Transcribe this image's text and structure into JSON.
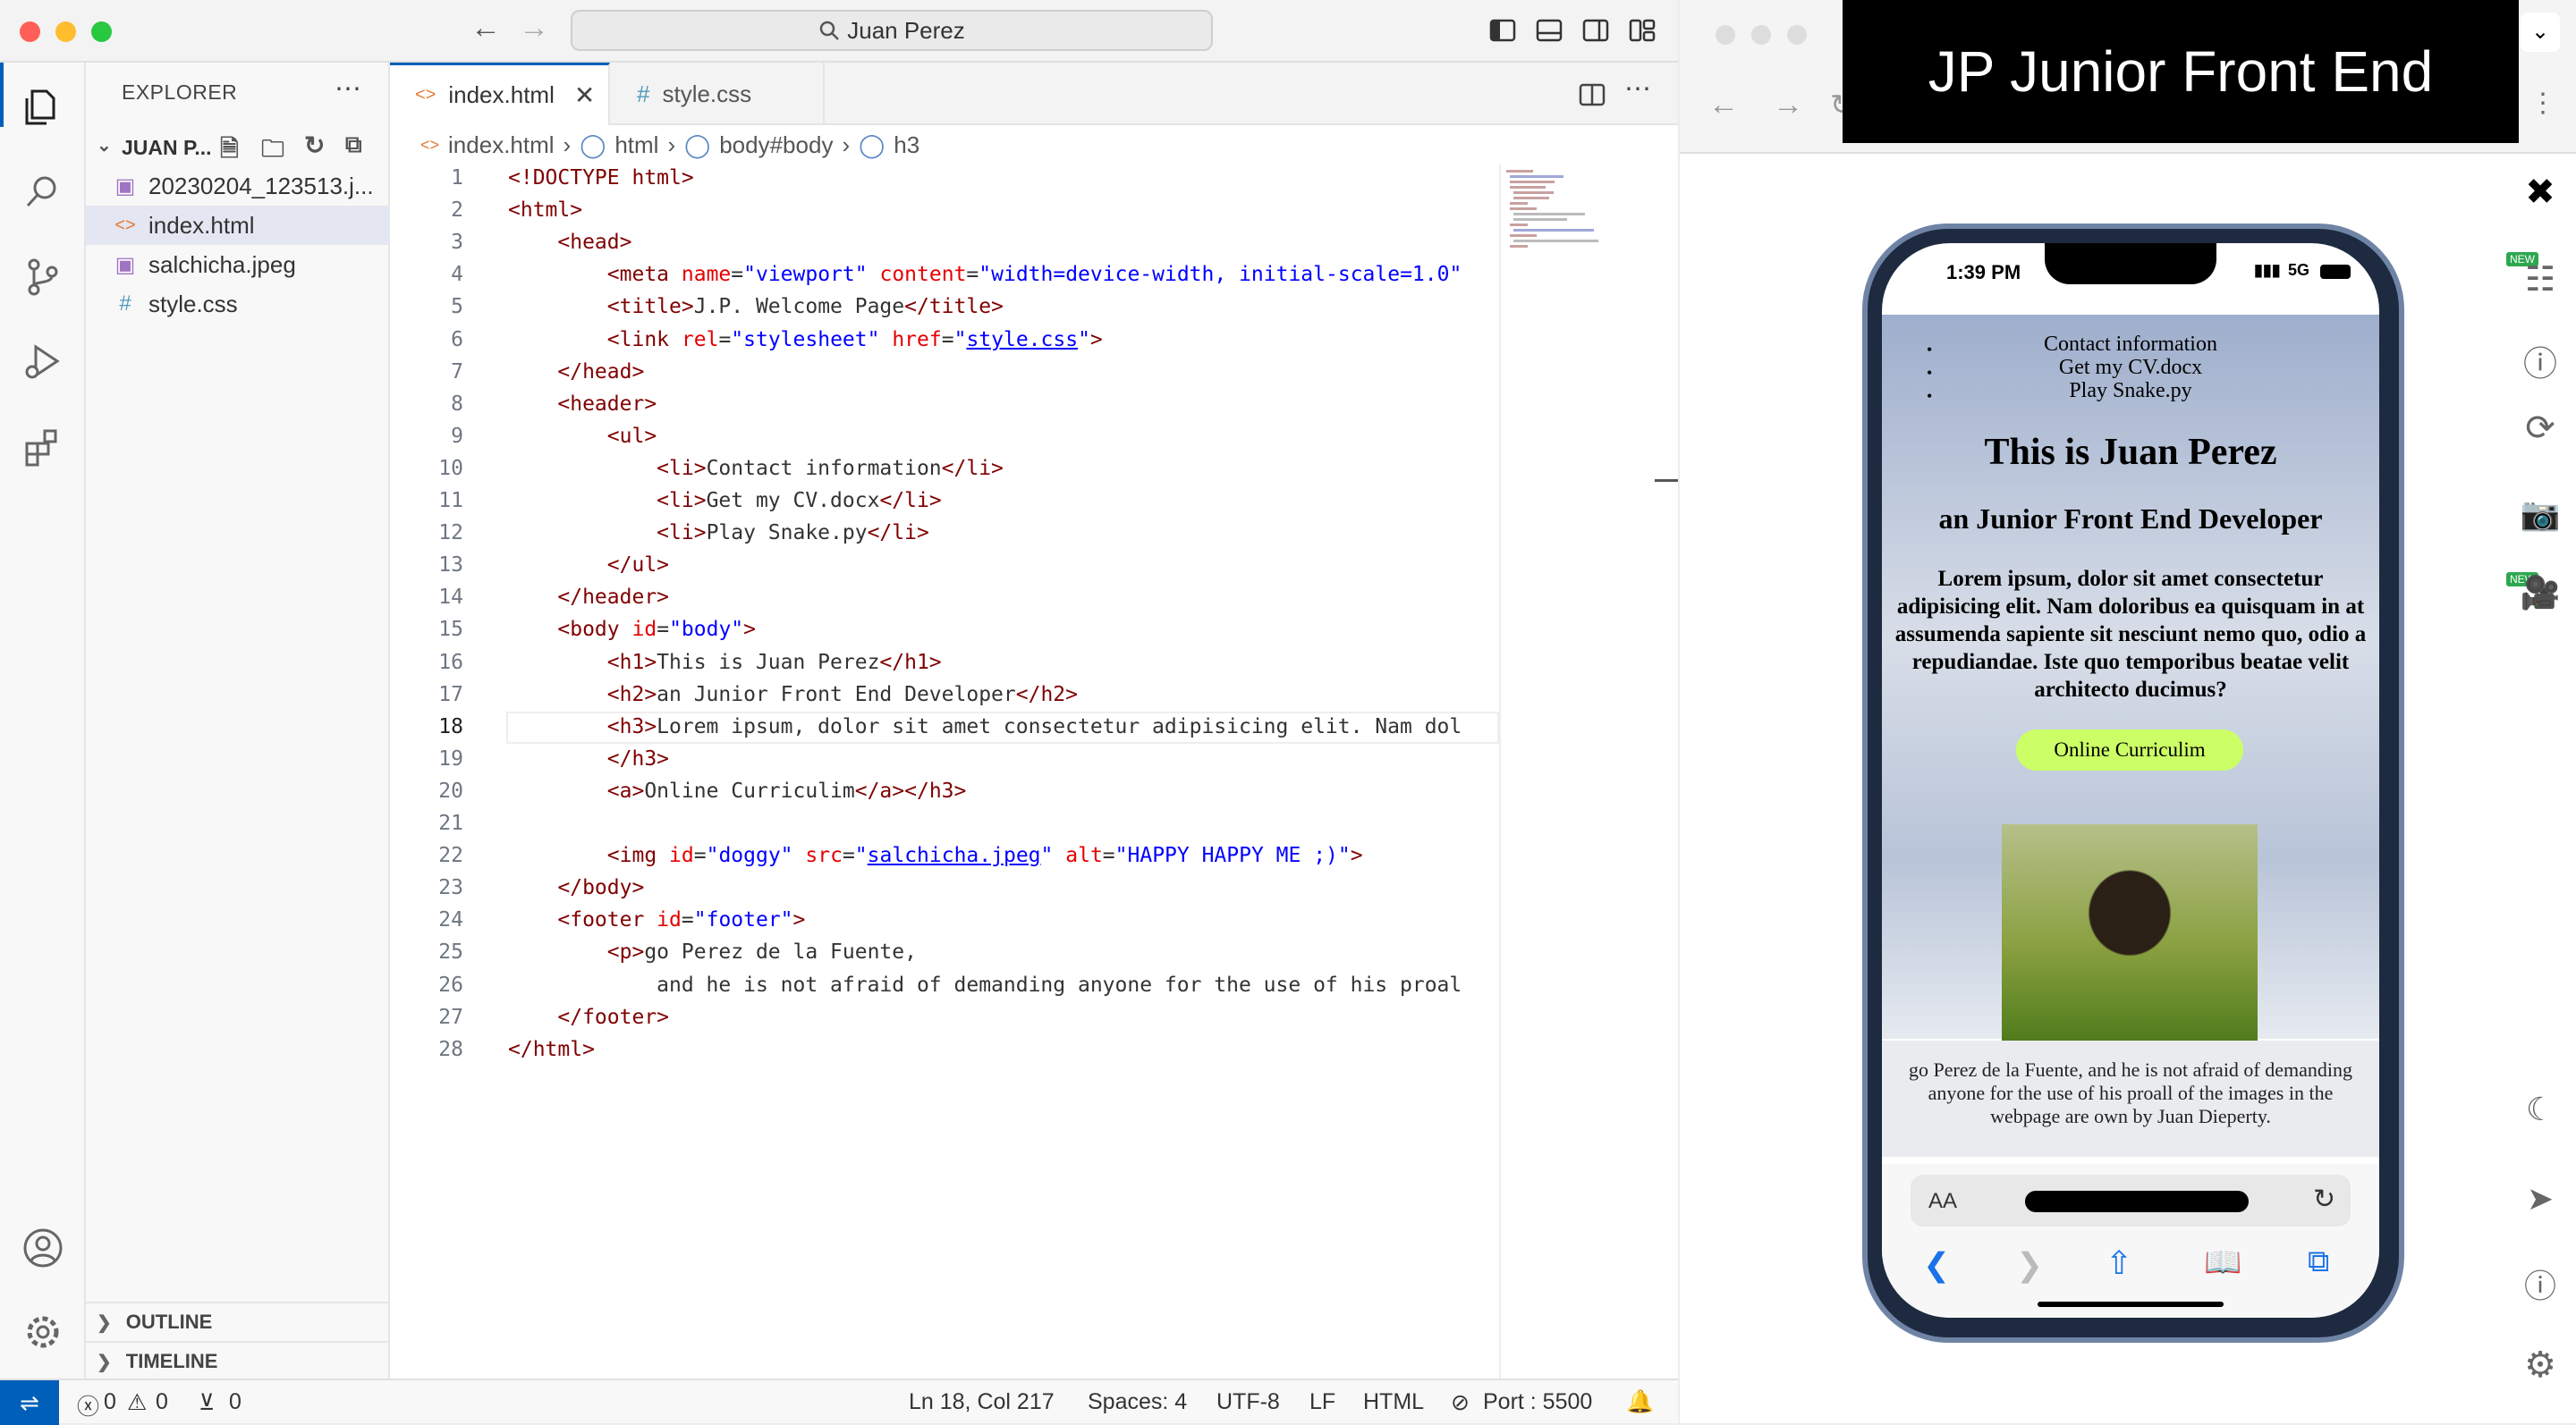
{
  "titlebar": {
    "search_text": "Juan Perez"
  },
  "explorer": {
    "title": "EXPLORER",
    "folder": "JUAN P...",
    "files": [
      {
        "name": "20230204_123513.j...",
        "icon": "image-icon"
      },
      {
        "name": "index.html",
        "icon": "html-icon"
      },
      {
        "name": "salchicha.jpeg",
        "icon": "image-icon"
      },
      {
        "name": "style.css",
        "icon": "css-icon"
      }
    ],
    "outline": "OUTLINE",
    "timeline": "TIMELINE"
  },
  "tabs": [
    {
      "label": "index.html",
      "icon": "<>"
    },
    {
      "label": "style.css",
      "icon": "#"
    }
  ],
  "breadcrumb": [
    "index.html",
    "html",
    "body#body",
    "h3"
  ],
  "code_lines": [
    {
      "n": "1",
      "html": "<span class=\"tg\">&lt;!DOCTYPE html&gt;</span>"
    },
    {
      "n": "2",
      "html": "<span class=\"tg\">&lt;html&gt;</span>"
    },
    {
      "n": "3",
      "html": "    <span class=\"tg\">&lt;head&gt;</span>"
    },
    {
      "n": "4",
      "html": "        <span class=\"tg\">&lt;meta</span> <span class=\"at\">name</span>=<span class=\"st\">\"viewport\"</span> <span class=\"at\">content</span>=<span class=\"st\">\"width=device-width, initial-scale=1.0\"</span>"
    },
    {
      "n": "5",
      "html": "        <span class=\"tg\">&lt;title&gt;</span>J.P. Welcome Page<span class=\"tg\">&lt;/title&gt;</span>"
    },
    {
      "n": "6",
      "html": "        <span class=\"tg\">&lt;link</span> <span class=\"at\">rel</span>=<span class=\"st\">\"stylesheet\"</span> <span class=\"at\">href</span>=<span class=\"st\">\"</span><span class=\"u\">style.css</span><span class=\"st\">\"</span><span class=\"tg\">&gt;</span>"
    },
    {
      "n": "7",
      "html": "    <span class=\"tg\">&lt;/head&gt;</span>"
    },
    {
      "n": "8",
      "html": "    <span class=\"tg\">&lt;header&gt;</span>"
    },
    {
      "n": "9",
      "html": "        <span class=\"tg\">&lt;ul&gt;</span>"
    },
    {
      "n": "10",
      "html": "            <span class=\"tg\">&lt;li&gt;</span>Contact information<span class=\"tg\">&lt;/li&gt;</span>"
    },
    {
      "n": "11",
      "html": "            <span class=\"tg\">&lt;li&gt;</span>Get my CV.docx<span class=\"tg\">&lt;/li&gt;</span>"
    },
    {
      "n": "12",
      "html": "            <span class=\"tg\">&lt;li&gt;</span>Play Snake.py<span class=\"tg\">&lt;/li&gt;</span>"
    },
    {
      "n": "13",
      "html": "        <span class=\"tg\">&lt;/ul&gt;</span>"
    },
    {
      "n": "14",
      "html": "    <span class=\"tg\">&lt;/header&gt;</span>"
    },
    {
      "n": "15",
      "html": "    <span class=\"tg\">&lt;body</span> <span class=\"at\">id</span>=<span class=\"st\">\"body\"</span><span class=\"tg\">&gt;</span>"
    },
    {
      "n": "16",
      "html": "        <span class=\"tg\">&lt;h1&gt;</span>This is Juan Perez<span class=\"tg\">&lt;/h1&gt;</span>"
    },
    {
      "n": "17",
      "html": "        <span class=\"tg\">&lt;h2&gt;</span>an Junior Front End Developer<span class=\"tg\">&lt;/h2&gt;</span>"
    },
    {
      "n": "18",
      "html": "        <span class=\"tg\">&lt;h3&gt;</span>Lorem ipsum, dolor sit amet consectetur adipisicing elit. Nam dol"
    },
    {
      "n": "19",
      "html": "        <span class=\"tg\">&lt;/h3&gt;</span>"
    },
    {
      "n": "20",
      "html": "        <span class=\"tg\">&lt;a&gt;</span>Online Curriculim<span class=\"tg\">&lt;/a&gt;&lt;/h3&gt;</span>"
    },
    {
      "n": "21",
      "html": ""
    },
    {
      "n": "22",
      "html": "        <span class=\"tg\">&lt;img</span> <span class=\"at\">id</span>=<span class=\"st\">\"doggy\"</span> <span class=\"at\">src</span>=<span class=\"st\">\"</span><span class=\"u\">salchicha.jpeg</span><span class=\"st\">\"</span> <span class=\"at\">alt</span>=<span class=\"st\">\"HAPPY HAPPY ME ;)\"</span><span class=\"tg\">&gt;</span>"
    },
    {
      "n": "23",
      "html": "    <span class=\"tg\">&lt;/body&gt;</span>"
    },
    {
      "n": "24",
      "html": "    <span class=\"tg\">&lt;footer</span> <span class=\"at\">id</span>=<span class=\"st\">\"footer\"</span><span class=\"tg\">&gt;</span>"
    },
    {
      "n": "25",
      "html": "        <span class=\"tg\">&lt;p&gt;</span>go Perez de la Fuente,"
    },
    {
      "n": "26",
      "html": "            and he is not afraid of demanding anyone for the use of his proal"
    },
    {
      "n": "27",
      "html": "    <span class=\"tg\">&lt;/footer&gt;</span>"
    },
    {
      "n": "28",
      "html": "<span class=\"tg\">&lt;/html&gt;</span>"
    }
  ],
  "statusbar": {
    "errors": "0",
    "warnings": "0",
    "ports": "0",
    "position": "Ln 18, Col 217",
    "spaces": "Spaces: 4",
    "encoding": "UTF-8",
    "eol": "LF",
    "language": "HTML",
    "port": "Port : 5500"
  },
  "banner": "JP Junior Front End",
  "phone": {
    "time": "1:39 PM",
    "network": "5G",
    "nav_items": [
      "Contact information",
      "Get my CV.docx",
      "Play Snake.py"
    ],
    "h1": "This is Juan Perez",
    "h2": "an Junior Front End Developer",
    "h3": "Lorem ipsum, dolor sit amet consectetur adipisicing elit. Nam doloribus ea quisquam in at assumenda sapiente sit nesciunt nemo quo, odio a repudiandae. Iste quo temporibus beatae velit architecto ducimus?",
    "button": "Online Curriculim",
    "footer": "go Perez de la Fuente, and he is not afraid of demanding anyone for the use of his proall of the images in the webpage are own by Juan Dieperty.",
    "aa": "AA"
  },
  "rail_badges": [
    "NEW",
    "NEW"
  ]
}
